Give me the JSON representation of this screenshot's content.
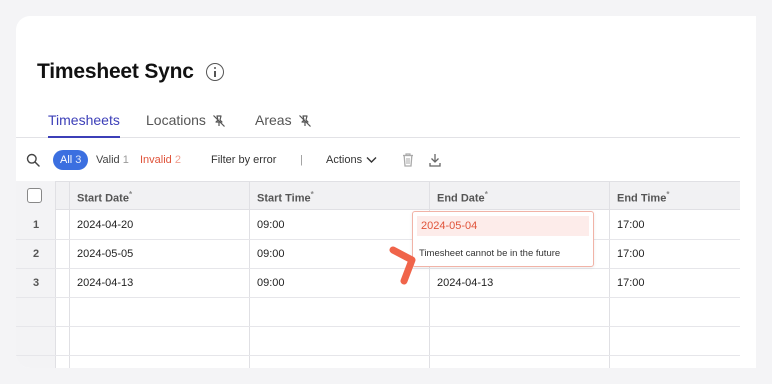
{
  "header": {
    "title": "Timesheet Sync"
  },
  "tabs": [
    {
      "label": "Timesheets",
      "active": true
    },
    {
      "label": "Locations",
      "icon": "pin-off-icon"
    },
    {
      "label": "Areas",
      "icon": "pin-off-icon"
    }
  ],
  "toolbar": {
    "all_label": "All",
    "all_count": "3",
    "valid_label": "Valid",
    "valid_count": "1",
    "invalid_label": "Invalid",
    "invalid_count": "2",
    "filter_label": "Filter by error",
    "separator": "|",
    "actions_label": "Actions"
  },
  "table": {
    "columns": [
      {
        "label": "Start Date",
        "required": "*"
      },
      {
        "label": "Start Time",
        "required": "*"
      },
      {
        "label": "End Date",
        "required": "*"
      },
      {
        "label": "End Time",
        "required": "*"
      }
    ],
    "rows": [
      {
        "num": "1",
        "start_date": "2024-04-20",
        "start_time": "09:00",
        "end_date": "2024-05-04",
        "end_time": "17:00"
      },
      {
        "num": "2",
        "start_date": "2024-05-05",
        "start_time": "09:00",
        "end_date": "",
        "end_time": "17:00"
      },
      {
        "num": "3",
        "start_date": "2024-04-13",
        "start_time": "09:00",
        "end_date": "2024-04-13",
        "end_time": "17:00"
      }
    ]
  },
  "error_popup": {
    "value": "2024-05-04",
    "message": "Timesheet cannot be in the future"
  },
  "colors": {
    "accent": "#3c3fb8",
    "pill": "#3b6fe0",
    "error": "#e0533a",
    "annotation": "#f0644a"
  }
}
